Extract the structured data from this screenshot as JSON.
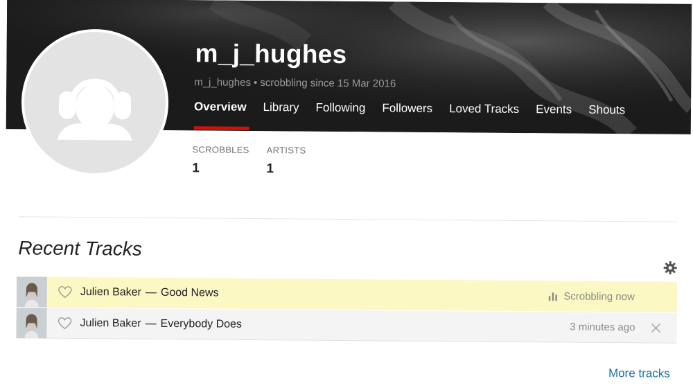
{
  "profile": {
    "username": "m_j_hughes",
    "subline_user": "m_j_hughes",
    "subline_since": "scrobbling since 15 Mar 2016"
  },
  "nav": {
    "items": [
      {
        "label": "Overview",
        "active": true
      },
      {
        "label": "Library"
      },
      {
        "label": "Following"
      },
      {
        "label": "Followers"
      },
      {
        "label": "Loved Tracks"
      },
      {
        "label": "Events"
      },
      {
        "label": "Shouts"
      }
    ],
    "indicator_color": "#d51007"
  },
  "stats": [
    {
      "label": "SCROBBLES",
      "value": "1"
    },
    {
      "label": "ARTISTS",
      "value": "1"
    }
  ],
  "recent": {
    "title": "Recent Tracks",
    "tracks": [
      {
        "artist": "Julien Baker",
        "separator": "—",
        "title": "Good News",
        "status": "Scrobbling now",
        "now_playing": true
      },
      {
        "artist": "Julien Baker",
        "separator": "—",
        "title": "Everybody Does",
        "status": "3 minutes ago",
        "now_playing": false
      }
    ],
    "more_label": "More tracks"
  },
  "icons": [
    "headphones-avatar-icon",
    "gear-icon",
    "heart-icon",
    "bars-icon",
    "close-icon"
  ],
  "colors": {
    "now_playing_bg": "#fbf8c4",
    "link": "#1a6ea8",
    "banner": "#1c1c1c"
  }
}
